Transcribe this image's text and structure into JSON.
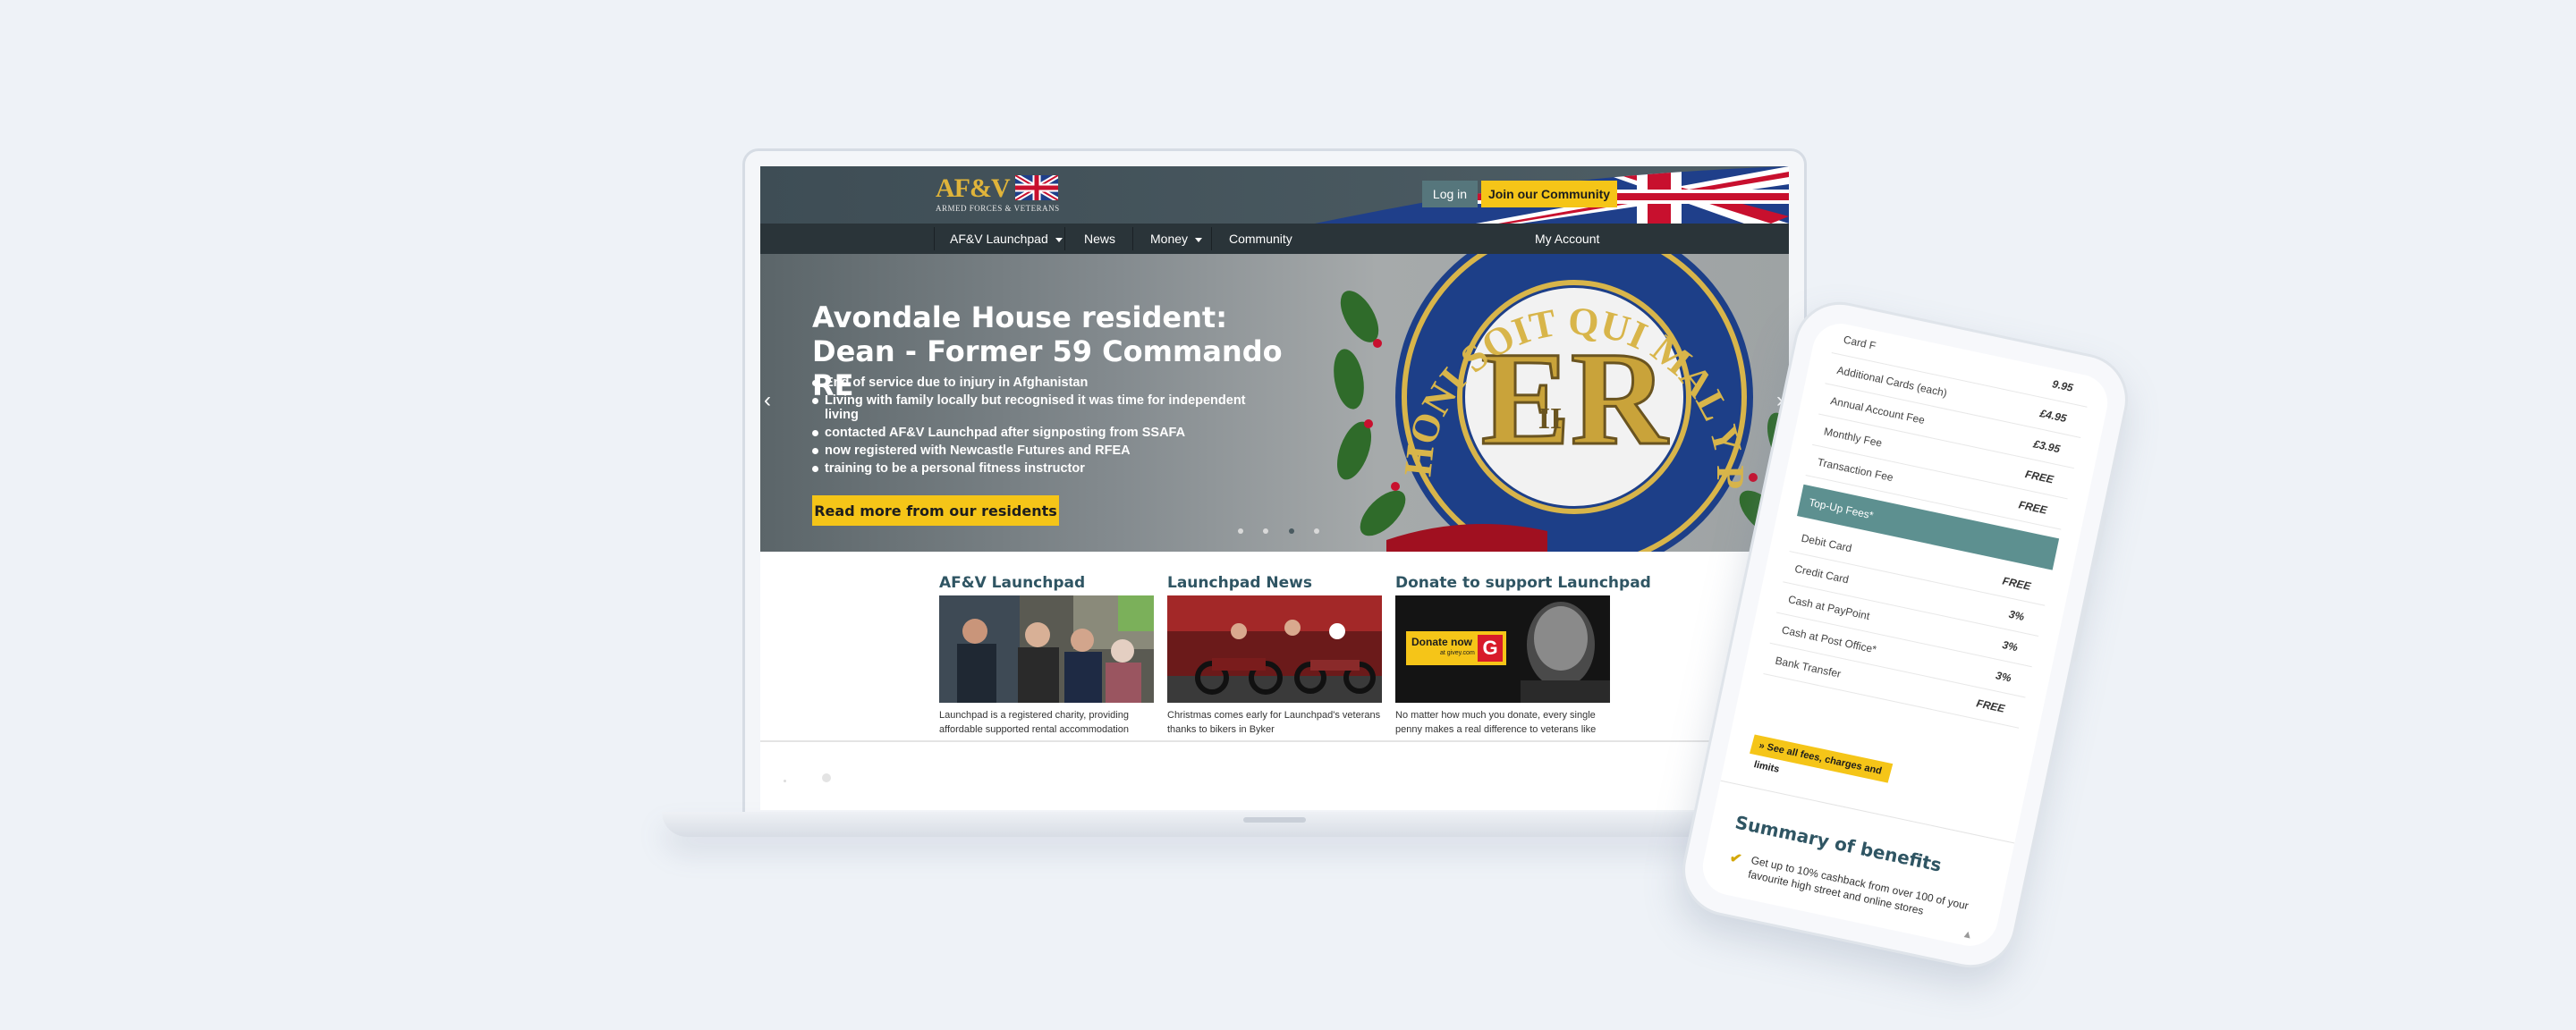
{
  "site": {
    "logo_text": "AF&V",
    "logo_subtitle": "ARMED FORCES & VETERANS",
    "login_label": "Log in",
    "join_label": "Join our Community",
    "nav": [
      {
        "label": "AF&V Launchpad",
        "has_caret": true
      },
      {
        "label": "News",
        "has_caret": false
      },
      {
        "label": "Money",
        "has_caret": true
      },
      {
        "label": "Community",
        "has_caret": false
      },
      {
        "label": "My Account",
        "has_caret": false
      }
    ],
    "hero": {
      "title": "Avondale House resident: Dean - Former 59 Commando RE",
      "bullets": [
        "End of service due to injury in Afghanistan",
        "Living with family locally but recognised it was time for independent living",
        "contacted AF&V Launchpad after signposting from SSAFA",
        "now registered with Newcastle Futures and RFEA",
        "training to be a personal fitness instructor"
      ],
      "cta": "Read more from our residents",
      "prev_arrow": "‹",
      "next_arrow": "›",
      "slides": 4,
      "active_slide": 3
    },
    "columns": [
      {
        "title": "AF&V Launchpad",
        "text": "Launchpad is a registered charity, providing affordable supported rental accommodation"
      },
      {
        "title": "Launchpad News",
        "text": "Christmas comes early for Launchpad's veterans thanks to bikers in Byker"
      },
      {
        "title": "Donate to support Launchpad",
        "text": "No matter how much you donate, every single penny makes a real difference to veterans like",
        "donate_badge": "Donate now",
        "donate_sub": "at givey.com",
        "donate_g": "G"
      }
    ]
  },
  "phone": {
    "card_fees": [
      {
        "label": "Card F",
        "value": "9.95"
      },
      {
        "label": "Additional Cards (each)",
        "value": "£4.95"
      },
      {
        "label": "Annual Account Fee",
        "value": "£3.95"
      },
      {
        "label": "Monthly Fee",
        "value": "FREE"
      },
      {
        "label": "Transaction Fee",
        "value": "FREE"
      }
    ],
    "topup_header": "Top-Up Fees*",
    "topup_fees": [
      {
        "label": "Debit Card",
        "value": "FREE"
      },
      {
        "label": "Credit Card",
        "value": "3%"
      },
      {
        "label": "Cash at PayPoint",
        "value": "3%"
      },
      {
        "label": "Cash at Post Office*",
        "value": "3%"
      },
      {
        "label": "Bank Transfer",
        "value": "FREE"
      }
    ],
    "fees_link": "» See all fees, charges and limits",
    "summary_title": "Summary of benefits",
    "benefit_check": "✔",
    "benefit_text": "Get up to 10% cashback from over 100 of your favourite high street and online stores",
    "scroll_arrow": "▲"
  },
  "colors": {
    "accent_yellow": "#f5c518",
    "header_teal": "#56767c",
    "heading_blue": "#2f5563",
    "nav_dark": "#2a3439",
    "topup_teal": "#5d9090",
    "background": "#eef2f7"
  },
  "icons": [
    "union-jack-flag-icon",
    "caret-down-icon",
    "chevron-left-icon",
    "chevron-right-icon",
    "check-icon",
    "arrow-up-icon",
    "crest-badge-icon"
  ]
}
